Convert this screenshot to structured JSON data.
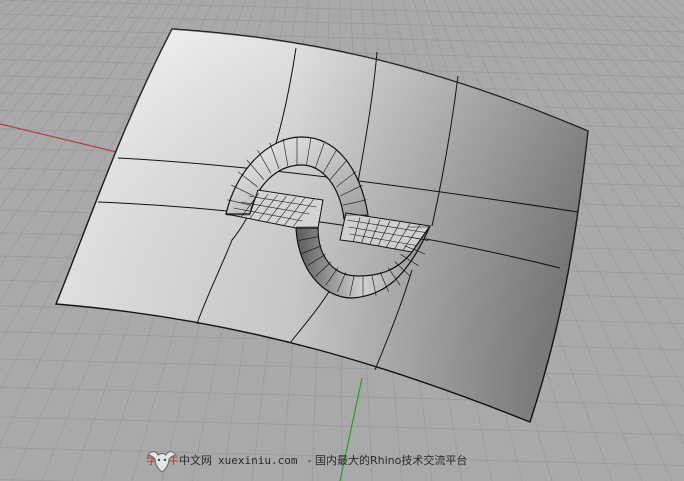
{
  "viewport": {
    "background_color": "#a9a9a9",
    "grid_color": "#9a9a9a",
    "x_axis_color": "#b04040",
    "y_axis_color": "#2aa02a",
    "surface_light": "#f7f7f7",
    "surface_dark": "#6e6e6e",
    "wire_color": "#111111"
  },
  "watermark": {
    "logo_icon": "bull-head-logo",
    "brand_cn": "学犀牛",
    "brand_suffix": "中文网",
    "domain": "xuexiniu.com",
    "tagline": "- 国内最大的Rhino技术交流平台",
    "brand_color": "#c0392b"
  }
}
